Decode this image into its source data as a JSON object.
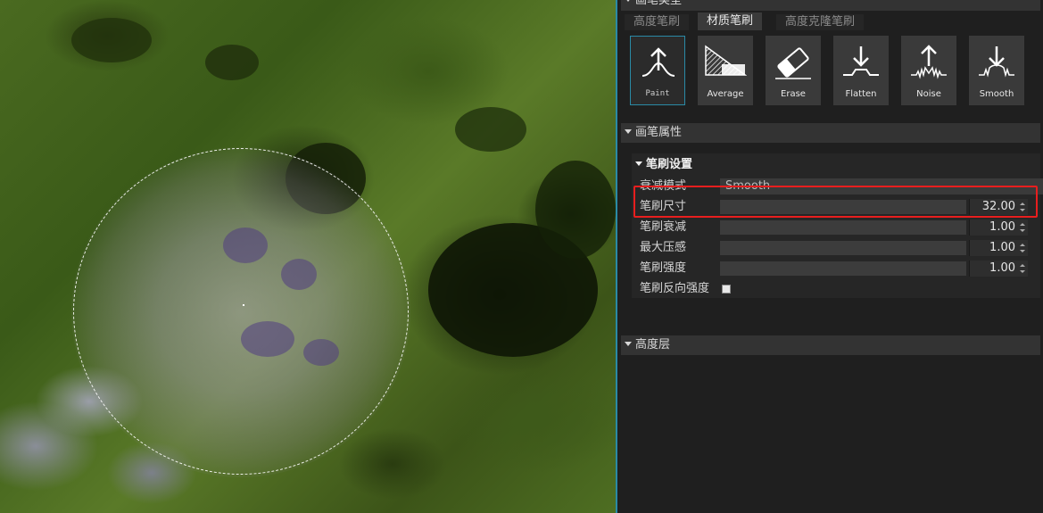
{
  "panel": {
    "top_header": "画笔类型",
    "tabs": [
      {
        "label": "高度笔刷",
        "active": false
      },
      {
        "label": "材质笔刷",
        "active": true
      },
      {
        "label": "高度克隆笔刷",
        "active": false
      }
    ],
    "tools": [
      {
        "label": "Paint",
        "icon": "paint-brush-icon",
        "active": true
      },
      {
        "label": "Average",
        "icon": "average-brush-icon",
        "active": false
      },
      {
        "label": "Erase",
        "icon": "eraser-icon",
        "active": false
      },
      {
        "label": "Flatten",
        "icon": "flatten-brush-icon",
        "active": false
      },
      {
        "label": "Noise",
        "icon": "noise-brush-icon",
        "active": false
      },
      {
        "label": "Smooth",
        "icon": "smooth-brush-icon",
        "active": false
      }
    ],
    "brush_properties_header": "画笔属性",
    "brush_settings": {
      "title": "笔刷设置",
      "falloff_mode_label": "衰减模式",
      "falloff_mode_value": "Smooth",
      "rows": [
        {
          "label": "笔刷尺寸",
          "value": "32.00"
        },
        {
          "label": "笔刷衰减",
          "value": "1.00"
        },
        {
          "label": "最大压感",
          "value": "1.00"
        },
        {
          "label": "笔刷强度",
          "value": "1.00"
        }
      ],
      "invert_label": "笔刷反向强度",
      "invert_checked": false
    },
    "height_layer_header": "高度层"
  },
  "colors": {
    "accent": "#2a8aa6",
    "highlight": "#e81e1e",
    "panel_bg": "#1f1f1f"
  }
}
